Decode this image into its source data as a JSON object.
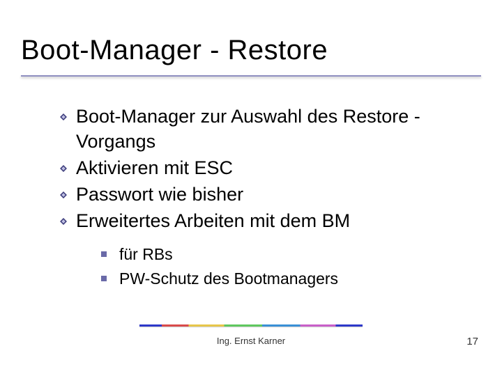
{
  "title": "Boot-Manager - Restore",
  "bullets": [
    "Boot-Manager zur Auswahl des Restore -Vorgangs",
    "Aktivieren mit ESC",
    "Passwort wie bisher",
    "Erweitertes Arbeiten mit dem BM"
  ],
  "sub_bullets": [
    "für RBs",
    "PW-Schutz des Bootmanagers"
  ],
  "footer": {
    "author": "Ing. Ernst Karner",
    "page": "17"
  },
  "colors": {
    "underline": "#8e8ec0",
    "sub_square": "#6a6aa8"
  }
}
